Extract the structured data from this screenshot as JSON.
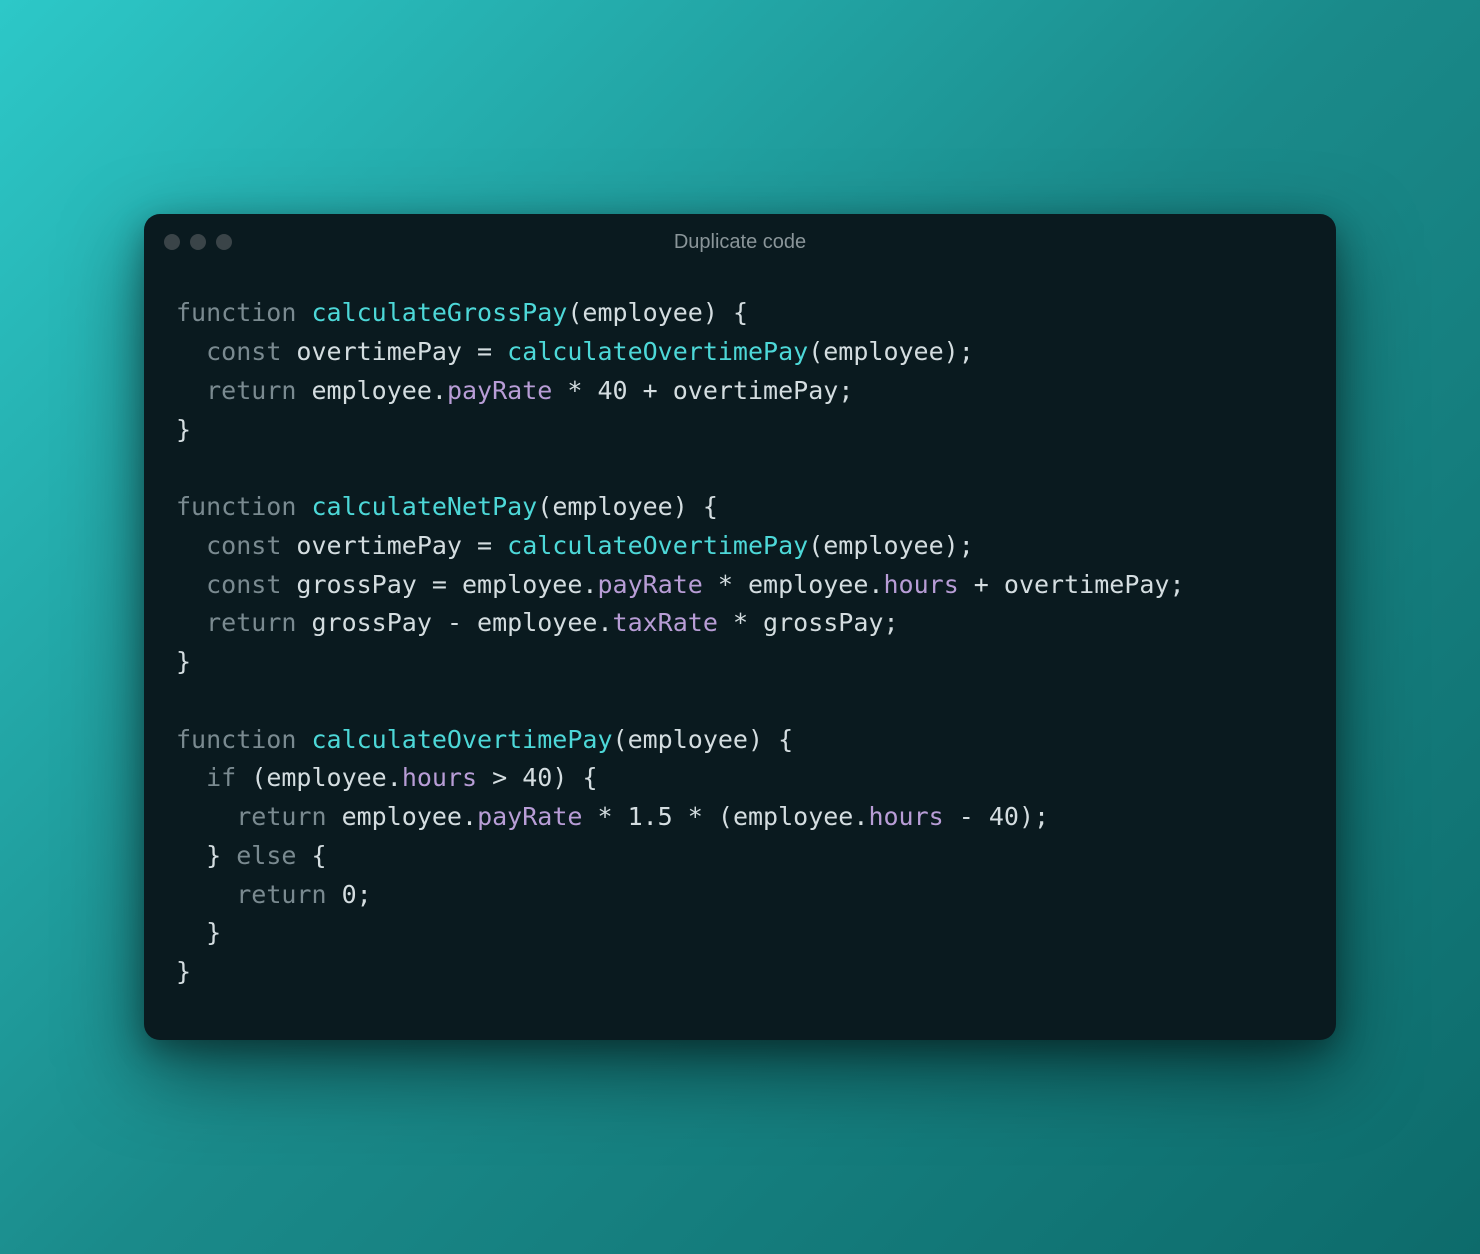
{
  "window": {
    "title": "Duplicate code"
  },
  "code": {
    "tokens": [
      [
        {
          "t": "function ",
          "c": "keyword"
        },
        {
          "t": "calculateGrossPay",
          "c": "funcname"
        },
        {
          "t": "(",
          "c": "paren"
        },
        {
          "t": "employee",
          "c": "param"
        },
        {
          "t": ")",
          "c": "paren"
        },
        {
          "t": " {",
          "c": "brace"
        }
      ],
      [
        {
          "t": "  ",
          "c": ""
        },
        {
          "t": "const ",
          "c": "const"
        },
        {
          "t": "overtimePay",
          "c": "varname"
        },
        {
          "t": " = ",
          "c": "operator"
        },
        {
          "t": "calculateOvertimePay",
          "c": "call"
        },
        {
          "t": "(",
          "c": "paren"
        },
        {
          "t": "employee",
          "c": "param"
        },
        {
          "t": ")",
          "c": "paren"
        },
        {
          "t": ";",
          "c": "semi"
        }
      ],
      [
        {
          "t": "  ",
          "c": ""
        },
        {
          "t": "return ",
          "c": "return"
        },
        {
          "t": "employee",
          "c": "obj"
        },
        {
          "t": ".",
          "c": "dot"
        },
        {
          "t": "payRate",
          "c": "prop"
        },
        {
          "t": " * ",
          "c": "operator"
        },
        {
          "t": "40",
          "c": "number"
        },
        {
          "t": " + ",
          "c": "operator"
        },
        {
          "t": "overtimePay",
          "c": "varname"
        },
        {
          "t": ";",
          "c": "semi"
        }
      ],
      [
        {
          "t": "}",
          "c": "brace"
        }
      ],
      [
        {
          "t": "",
          "c": ""
        }
      ],
      [
        {
          "t": "function ",
          "c": "keyword"
        },
        {
          "t": "calculateNetPay",
          "c": "funcname"
        },
        {
          "t": "(",
          "c": "paren"
        },
        {
          "t": "employee",
          "c": "param"
        },
        {
          "t": ")",
          "c": "paren"
        },
        {
          "t": " {",
          "c": "brace"
        }
      ],
      [
        {
          "t": "  ",
          "c": ""
        },
        {
          "t": "const ",
          "c": "const"
        },
        {
          "t": "overtimePay",
          "c": "varname"
        },
        {
          "t": " = ",
          "c": "operator"
        },
        {
          "t": "calculateOvertimePay",
          "c": "call"
        },
        {
          "t": "(",
          "c": "paren"
        },
        {
          "t": "employee",
          "c": "param"
        },
        {
          "t": ")",
          "c": "paren"
        },
        {
          "t": ";",
          "c": "semi"
        }
      ],
      [
        {
          "t": "  ",
          "c": ""
        },
        {
          "t": "const ",
          "c": "const"
        },
        {
          "t": "grossPay",
          "c": "varname"
        },
        {
          "t": " = ",
          "c": "operator"
        },
        {
          "t": "employee",
          "c": "obj"
        },
        {
          "t": ".",
          "c": "dot"
        },
        {
          "t": "payRate",
          "c": "prop"
        },
        {
          "t": " * ",
          "c": "operator"
        },
        {
          "t": "employee",
          "c": "obj"
        },
        {
          "t": ".",
          "c": "dot"
        },
        {
          "t": "hours",
          "c": "prop"
        },
        {
          "t": " + ",
          "c": "operator"
        },
        {
          "t": "overtimePay",
          "c": "varname"
        },
        {
          "t": ";",
          "c": "semi"
        }
      ],
      [
        {
          "t": "  ",
          "c": ""
        },
        {
          "t": "return ",
          "c": "return"
        },
        {
          "t": "grossPay",
          "c": "varname"
        },
        {
          "t": " - ",
          "c": "operator"
        },
        {
          "t": "employee",
          "c": "obj"
        },
        {
          "t": ".",
          "c": "dot"
        },
        {
          "t": "taxRate",
          "c": "prop"
        },
        {
          "t": " * ",
          "c": "operator"
        },
        {
          "t": "grossPay",
          "c": "varname"
        },
        {
          "t": ";",
          "c": "semi"
        }
      ],
      [
        {
          "t": "}",
          "c": "brace"
        }
      ],
      [
        {
          "t": "",
          "c": ""
        }
      ],
      [
        {
          "t": "function ",
          "c": "keyword"
        },
        {
          "t": "calculateOvertimePay",
          "c": "funcname"
        },
        {
          "t": "(",
          "c": "paren"
        },
        {
          "t": "employee",
          "c": "param"
        },
        {
          "t": ")",
          "c": "paren"
        },
        {
          "t": " {",
          "c": "brace"
        }
      ],
      [
        {
          "t": "  ",
          "c": ""
        },
        {
          "t": "if ",
          "c": "if"
        },
        {
          "t": "(",
          "c": "paren"
        },
        {
          "t": "employee",
          "c": "obj"
        },
        {
          "t": ".",
          "c": "dot"
        },
        {
          "t": "hours",
          "c": "prop"
        },
        {
          "t": " > ",
          "c": "operator"
        },
        {
          "t": "40",
          "c": "number"
        },
        {
          "t": ")",
          "c": "paren"
        },
        {
          "t": " {",
          "c": "brace"
        }
      ],
      [
        {
          "t": "    ",
          "c": ""
        },
        {
          "t": "return ",
          "c": "return"
        },
        {
          "t": "employee",
          "c": "obj"
        },
        {
          "t": ".",
          "c": "dot"
        },
        {
          "t": "payRate",
          "c": "prop"
        },
        {
          "t": " * ",
          "c": "operator"
        },
        {
          "t": "1.5",
          "c": "number"
        },
        {
          "t": " * ",
          "c": "operator"
        },
        {
          "t": "(",
          "c": "paren"
        },
        {
          "t": "employee",
          "c": "obj"
        },
        {
          "t": ".",
          "c": "dot"
        },
        {
          "t": "hours",
          "c": "prop"
        },
        {
          "t": " - ",
          "c": "operator"
        },
        {
          "t": "40",
          "c": "number"
        },
        {
          "t": ")",
          "c": "paren"
        },
        {
          "t": ";",
          "c": "semi"
        }
      ],
      [
        {
          "t": "  } ",
          "c": "brace"
        },
        {
          "t": "else",
          "c": "else"
        },
        {
          "t": " {",
          "c": "brace"
        }
      ],
      [
        {
          "t": "    ",
          "c": ""
        },
        {
          "t": "return ",
          "c": "return"
        },
        {
          "t": "0",
          "c": "number"
        },
        {
          "t": ";",
          "c": "semi"
        }
      ],
      [
        {
          "t": "  }",
          "c": "brace"
        }
      ],
      [
        {
          "t": "}",
          "c": "brace"
        }
      ]
    ]
  }
}
